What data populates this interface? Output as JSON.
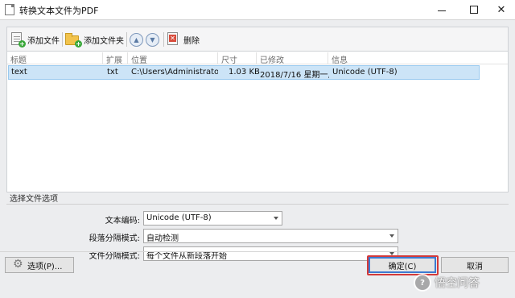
{
  "window": {
    "title": "转换文本文件为PDF",
    "minimize_symbol": "",
    "close_symbol": "✕"
  },
  "toolbar": {
    "add_file_label": "添加文件",
    "add_folder_label": "添加文件夹",
    "delete_label": "删除",
    "icons": {
      "add_file": "add-file-icon",
      "add_folder": "add-folder-icon",
      "move_up": "arrow-up-icon",
      "move_down": "arrow-down-icon",
      "delete": "delete-icon"
    }
  },
  "file_list": {
    "columns": [
      "标题",
      "扩展",
      "位置",
      "尺寸",
      "已修改",
      "信息"
    ],
    "rows": [
      {
        "title": "text",
        "ext": "txt",
        "location": "C:\\Users\\Administrato...",
        "size": "1.03 KB",
        "modified": "2018/7/16 星期一,...",
        "info": "Unicode (UTF-8)"
      }
    ]
  },
  "options": {
    "section_title": "选择文件选项",
    "text_encoding_label": "文本编码:",
    "text_encoding_value": "Unicode (UTF-8)",
    "paragraph_sep_label": "段落分隔模式:",
    "paragraph_sep_value": "自动检测",
    "file_sep_label": "文件分隔模式:",
    "file_sep_value": "每个文件从新段落开始"
  },
  "buttons": {
    "options_label": "选项(P)...",
    "ok_label": "确定(C)",
    "cancel_label": "取消"
  },
  "watermark": {
    "text": "悟空问答"
  },
  "colors": {
    "selected_row": "#cce4f7",
    "highlight_box": "#d33a3a",
    "ok_border": "#3d7bd1"
  }
}
